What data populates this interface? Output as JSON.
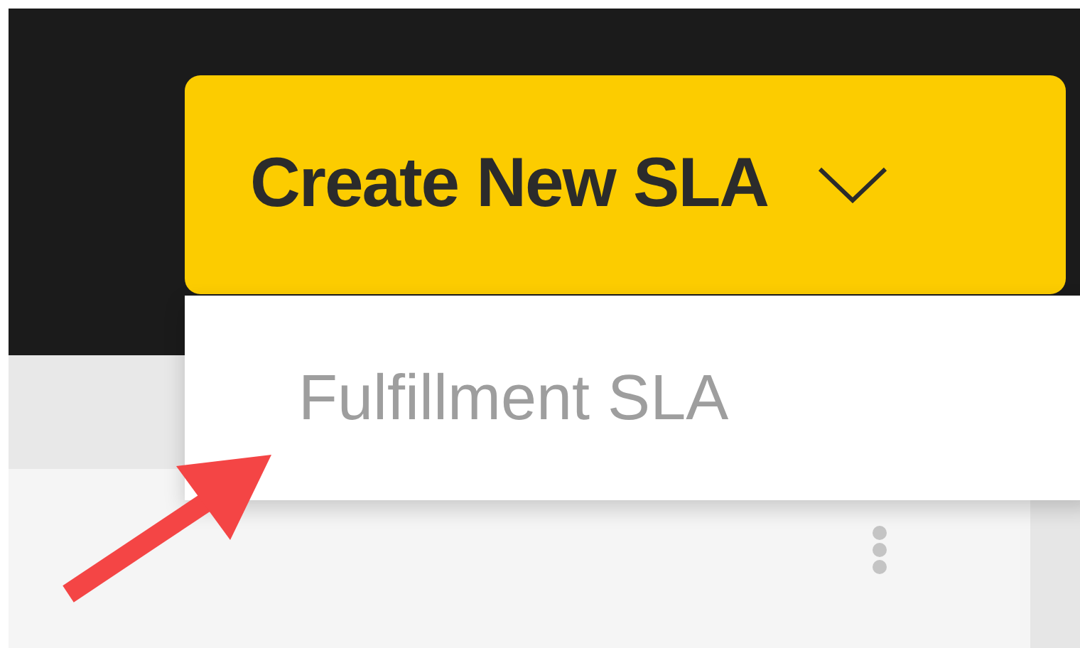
{
  "create_button": {
    "label": "Create New SLA",
    "expanded": true
  },
  "menu": {
    "items": [
      {
        "label": "Fulfillment SLA"
      }
    ]
  }
}
